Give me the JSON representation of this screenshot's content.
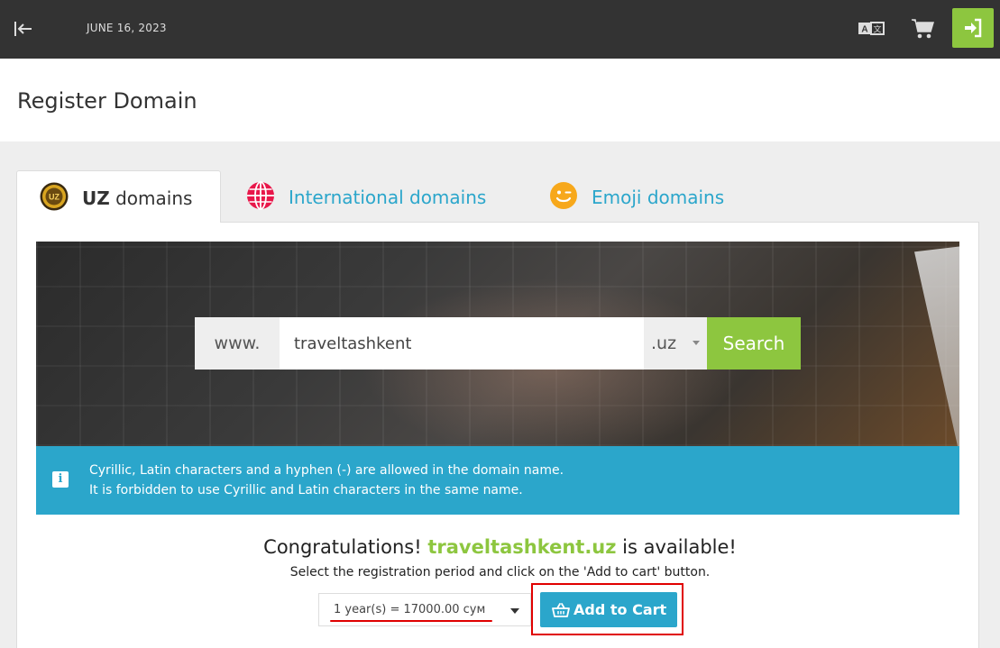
{
  "topbar": {
    "date": "JUNE 16, 2023",
    "icons": [
      "collapse-sidebar-icon",
      "translate-icon",
      "cart-icon",
      "login-icon"
    ],
    "accent": "#8dc63f",
    "background": "#333333"
  },
  "page": {
    "title": "Register Domain"
  },
  "tabs": [
    {
      "bold": "UZ",
      "label": " domains",
      "icon": "uz-coin-icon",
      "active": true
    },
    {
      "label": "International domains",
      "icon": "globe-icon",
      "active": false
    },
    {
      "label": "Emoji domains",
      "icon": "smiley-icon",
      "active": false
    }
  ],
  "search": {
    "prefix": "www.",
    "value": "traveltashkent",
    "tld": ".uz",
    "button": "Search"
  },
  "info": {
    "line1": "Cyrillic, Latin characters and a hyphen (-) are allowed in the domain name.",
    "line2": "It is forbidden to use Cyrillic and Latin characters in the same name.",
    "icon_text": "i"
  },
  "result": {
    "prefix": "Congratulations!",
    "domain": "traveltashkent.uz",
    "suffix": "is available!",
    "subtitle": "Select the registration period and click on the 'Add to cart' button.",
    "period": "1 year(s) = 17000.00 сум",
    "add_button": "Add to Cart"
  },
  "colors": {
    "primary_blue": "#2ba6cb",
    "green": "#8dc63f",
    "highlight_red": "#e00000"
  }
}
